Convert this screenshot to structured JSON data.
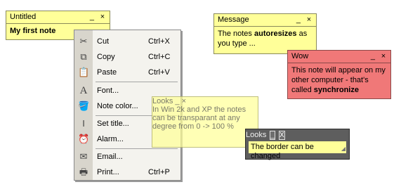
{
  "note_untitled": {
    "title": "Untitled",
    "min": "_",
    "close": "×",
    "text": "My first note"
  },
  "note_message": {
    "title": "Message",
    "min": "_",
    "close": "×",
    "text_pre": "The notes ",
    "text_bold": "autoresizes",
    "text_post": " as you type ..."
  },
  "note_wow": {
    "title": "Wow",
    "min": "_",
    "close": "×",
    "text_pre": "This note will appear on my other computer - that's called ",
    "text_bold": "synchronize"
  },
  "note_looks_transparent": {
    "title": "Looks",
    "min": "_",
    "close": "×",
    "text": "In Win 2k and XP the notes can be transparant at any degree from 0 -> 100 %"
  },
  "note_looks_border": {
    "title": "Looks",
    "min": "_",
    "close": "X",
    "text": "The border can be changed"
  },
  "context_menu": {
    "items": [
      {
        "label": "Cut",
        "shortcut": "Ctrl+X",
        "icon": "scissors-icon"
      },
      {
        "label": "Copy",
        "shortcut": "Ctrl+C",
        "icon": "copy-icon"
      },
      {
        "label": "Paste",
        "shortcut": "Ctrl+V",
        "icon": "paste-icon"
      },
      {
        "label": "Font...",
        "shortcut": "",
        "icon": "font-icon"
      },
      {
        "label": "Note color...",
        "shortcut": "",
        "icon": "paint-bucket-icon"
      },
      {
        "label": "Set title...",
        "shortcut": "",
        "icon": "text-cursor-icon"
      },
      {
        "label": "Alarm...",
        "shortcut": "",
        "icon": "alarm-icon"
      },
      {
        "label": "Email...",
        "shortcut": "",
        "icon": "email-icon"
      },
      {
        "label": "Print...",
        "shortcut": "Ctrl+P",
        "icon": "printer-icon"
      }
    ]
  },
  "colors": {
    "note_yellow": "#ffff99",
    "note_red": "#f07878",
    "note_dark_border": "#5e5e5e"
  }
}
